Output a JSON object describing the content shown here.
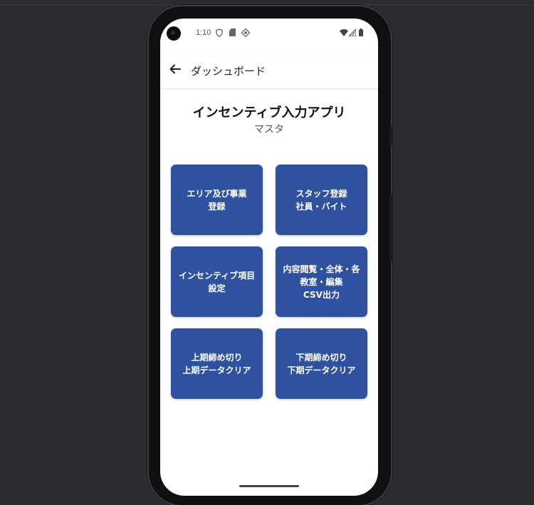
{
  "status_bar": {
    "time": "1:10",
    "icons_left": [
      "vpn-shield-icon",
      "sd-card-icon",
      "data-saver-icon"
    ],
    "icons_right": [
      "wifi-icon",
      "cellular-signal-icon",
      "battery-icon"
    ]
  },
  "app_bar": {
    "back_icon": "arrow-back-icon",
    "title": "ダッシュボード"
  },
  "header": {
    "title": "インセンティブ入力アプリ",
    "subtitle": "マスタ"
  },
  "tiles": [
    {
      "label": "エリア及び事業\n登録"
    },
    {
      "label": "スタッフ登録\n社員・バイト"
    },
    {
      "label": "インセンティブ項目\n設定"
    },
    {
      "label": "内容閲覧・全体・各\n教室・編集\nCSV出力"
    },
    {
      "label": "上期締め切り\n上期データクリア"
    },
    {
      "label": "下期締め切り\n下期データクリア"
    }
  ],
  "colors": {
    "tile_bg": "#2f52a0",
    "tile_text": "#ffffff",
    "screen_bg": "#ffffff",
    "outer_bg": "#2b2c30"
  }
}
